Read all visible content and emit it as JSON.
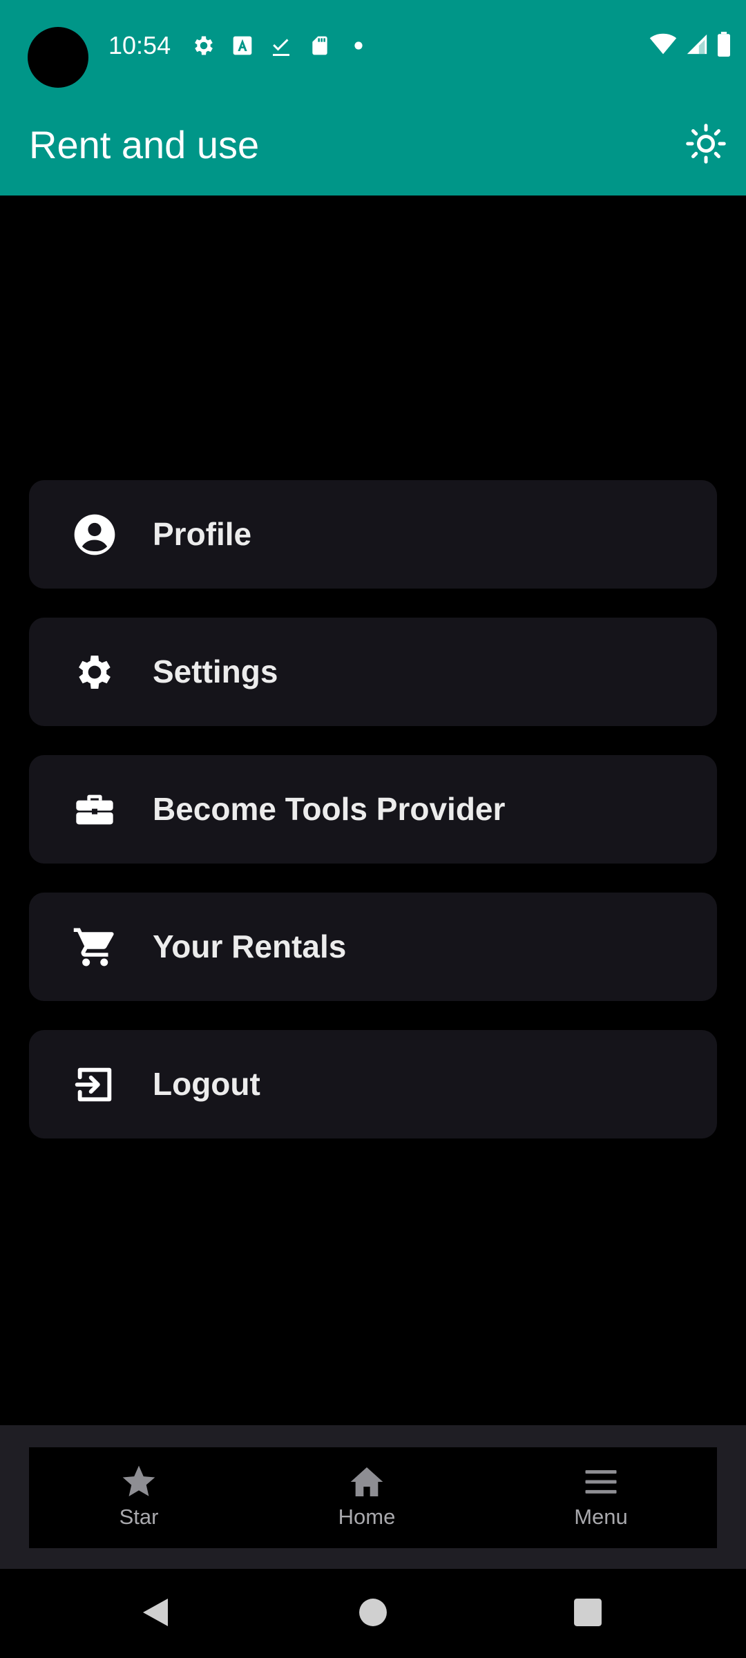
{
  "status_bar": {
    "time": "10:54",
    "icons_left": [
      "gear-icon",
      "font-a-icon",
      "download-check-icon",
      "sd-card-icon",
      "dot-icon"
    ],
    "icons_right": [
      "wifi-icon",
      "signal-icon",
      "battery-icon"
    ]
  },
  "app_bar": {
    "title": "Rent and use",
    "action_icon": "sun-icon"
  },
  "menu": {
    "items": [
      {
        "label": "Profile",
        "icon": "account-circle-icon"
      },
      {
        "label": "Settings",
        "icon": "gear-icon"
      },
      {
        "label": "Become Tools Provider",
        "icon": "briefcase-icon"
      },
      {
        "label": "Your Rentals",
        "icon": "cart-icon"
      },
      {
        "label": "Logout",
        "icon": "logout-icon"
      }
    ]
  },
  "bottom_nav": {
    "items": [
      {
        "label": "Star",
        "icon": "star-icon"
      },
      {
        "label": "Home",
        "icon": "home-icon"
      },
      {
        "label": "Menu",
        "icon": "menu-icon"
      }
    ]
  },
  "colors": {
    "app_bar": "#009688",
    "card": "#15141a",
    "nav_label": "#a9a9ad",
    "background": "#000000"
  }
}
